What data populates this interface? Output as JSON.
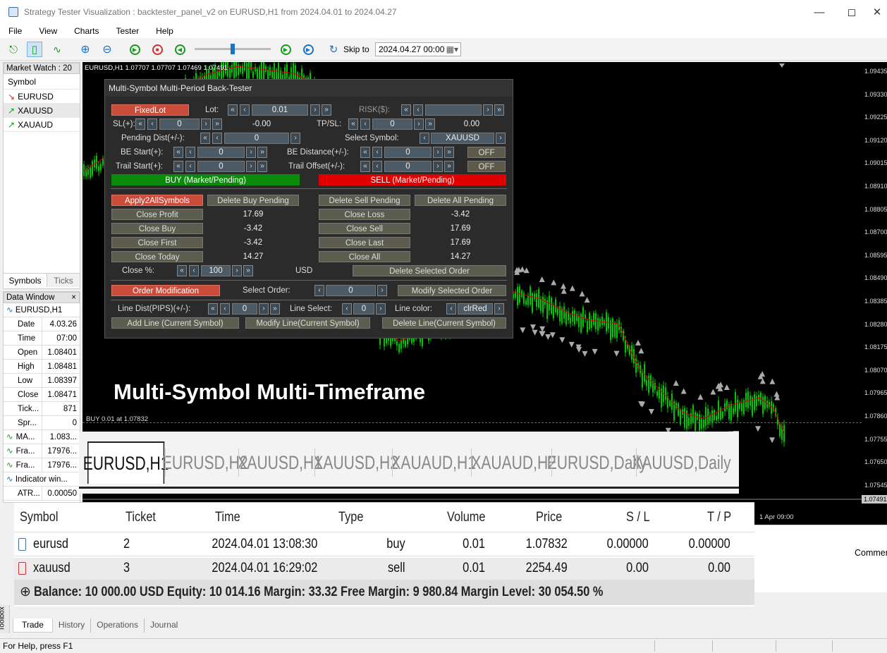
{
  "window": {
    "title": "Strategy Tester Visualization : backtester_panel_v2 on EURUSD,H1 from 2024.04.01 to 2024.04.27"
  },
  "menu": [
    "File",
    "View",
    "Charts",
    "Tester",
    "Help"
  ],
  "toolbar": {
    "skip_label": "Skip to",
    "skip_value": "2024.04.27 00:00",
    "slider_value": 0.5
  },
  "market_watch": {
    "title": "Market Watch : 20",
    "column": "Symbol",
    "symbols": [
      {
        "name": "EURUSD",
        "dir": "down"
      },
      {
        "name": "XAUUSD",
        "dir": "up"
      },
      {
        "name": "XAUAUD",
        "dir": "up"
      }
    ],
    "tabs": [
      "Symbols",
      "Ticks"
    ]
  },
  "data_window": {
    "title": "Data Window",
    "symbol": "EURUSD,H1",
    "rows": [
      {
        "k": "Date",
        "v": "4.03.26"
      },
      {
        "k": "Time",
        "v": "07:00"
      },
      {
        "k": "Open",
        "v": "1.08401"
      },
      {
        "k": "High",
        "v": "1.08481"
      },
      {
        "k": "Low",
        "v": "1.08397"
      },
      {
        "k": "Close",
        "v": "1.08471"
      },
      {
        "k": "Tick...",
        "v": "871"
      },
      {
        "k": "Spr...",
        "v": "0"
      }
    ],
    "indicators": [
      {
        "k": "MA...",
        "v": "1.083..."
      },
      {
        "k": "Fra...",
        "v": "17976..."
      },
      {
        "k": "Fra...",
        "v": "17976..."
      }
    ],
    "indicator_window": "Indicator win...",
    "atr": {
      "k": "ATR...",
      "v": "0.00050"
    }
  },
  "chart": {
    "header": "EURUSD,H1  1.07707 1.07707 1.07469 1.07491",
    "order_line": "BUY 0.01 at 1.07832",
    "banner": "Multi-Symbol Multi-Timeframe",
    "time_label": "1 Apr 09:00",
    "current_price": "1.07491",
    "price_labels": [
      "1.09435",
      "1.09330",
      "1.09225",
      "1.09120",
      "1.09015",
      "1.08910",
      "1.08805",
      "1.08700",
      "1.08595",
      "1.08490",
      "1.08385",
      "1.08280",
      "1.08175",
      "1.08070",
      "1.07965",
      "1.07860",
      "1.07755",
      "1.07650",
      "1.07545"
    ]
  },
  "panel": {
    "title": "Multi-Symbol Multi-Period Back-Tester",
    "fixedlot": "FixedLot",
    "lot_label": "Lot:",
    "lot_value": "0.01",
    "risk_label": "RISK($):",
    "sl_label": "SL(+):",
    "sl_value": "0",
    "sl_money": "-0.00",
    "tp_label": "TP/SL:",
    "tp_value": "0",
    "tp_money": "0.00",
    "pending_label": "Pending Dist(+/-):",
    "pending_value": "0",
    "symbol_label": "Select Symbol:",
    "symbol_value": "XAUUSD",
    "be_start_label": "BE Start(+):",
    "be_start_value": "0",
    "be_dist_label": "BE Distance(+/-):",
    "be_dist_value": "0",
    "be_toggle": "OFF",
    "trail_start_label": "Trail Start(+):",
    "trail_start_value": "0",
    "trail_offset_label": "Trail Offset(+/-):",
    "trail_offset_value": "0",
    "trail_toggle": "OFF",
    "buy": "BUY (Market/Pending)",
    "sell": "SELL (Market/Pending)",
    "apply_all": "Apply2AllSymbols",
    "del_buy_pending": "Delete Buy Pending",
    "del_sell_pending": "Delete Sell Pending",
    "del_all_pending": "Delete All Pending",
    "close_profit": "Close Profit",
    "close_profit_v": "17.69",
    "close_loss": "Close Loss",
    "close_loss_v": "-3.42",
    "close_buy": "Close Buy",
    "close_buy_v": "-3.42",
    "close_sell": "Close Sell",
    "close_sell_v": "17.69",
    "close_first": "Close First",
    "close_first_v": "-3.42",
    "close_last": "Close Last",
    "close_last_v": "17.69",
    "close_today": "Close Today",
    "close_today_v": "14.27",
    "close_all": "Close All",
    "close_all_v": "14.27",
    "close_pct_label": "Close %:",
    "close_pct_value": "100",
    "currency": "USD",
    "del_selected": "Delete Selected Order",
    "order_mod": "Order Modification",
    "select_order_label": "Select Order:",
    "select_order_value": "0",
    "modify_selected": "Modify Selected Order",
    "line_dist_label": "Line Dist(PIPS)(+/-):",
    "line_dist_value": "0",
    "line_select_label": "Line Select:",
    "line_select_value": "0",
    "line_color_label": "Line color:",
    "line_color_value": "clrRed",
    "add_line": "Add Line (Current Symbol)",
    "modify_line": "Modify Line(Current Symbol)",
    "delete_line": "Delete Line(Current Symbol)"
  },
  "chart_tabs": [
    "EURUSD,H1",
    "EURUSD,H2",
    "XAUUSD,H1",
    "XAUUSD,H2",
    "XAUAUD,H1",
    "XAUAUD,H2",
    "EURUSD,Daily",
    "XAUUSD,Daily"
  ],
  "trade": {
    "headers": [
      "Symbol",
      "Ticket",
      "Time",
      "Type",
      "Volume",
      "Price",
      "S / L",
      "T / P"
    ],
    "rows": [
      [
        "eurusd",
        "2",
        "2024.04.01 13:08:30",
        "buy",
        "0.01",
        "1.07832",
        "0.00000",
        "0.00000"
      ],
      [
        "xauusd",
        "3",
        "2024.04.01 16:29:02",
        "sell",
        "0.01",
        "2254.49",
        "0.00",
        "0.00"
      ]
    ],
    "balance": "Balance: 10 000.00 USD  Equity: 10 014.16  Margin: 33.32  Free Margin: 9 980.84  Margin Level: 30 054.50 %",
    "comment_header": "Commen"
  },
  "toolbox": {
    "label": "Toolbox",
    "tabs": [
      "Trade",
      "History",
      "Operations",
      "Journal"
    ]
  },
  "status": {
    "text": "For Help, press F1"
  },
  "colors": {
    "up": "#00c800",
    "panel_bg": "#2b2b2b",
    "buy": "#0c8a0c",
    "sell": "#e00000"
  }
}
